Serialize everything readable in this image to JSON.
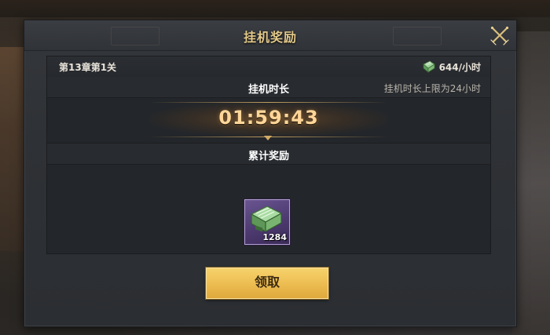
{
  "dialog": {
    "title": "挂机奖励",
    "close_icon": "crossed-swords-close-icon"
  },
  "stage": {
    "label": "第13章第1关",
    "rate_icon": "green-book-icon",
    "rate": "644/小时"
  },
  "duration": {
    "label": "挂机时长",
    "limit_note": "挂机时长上限为24小时",
    "timer": "01:59:43"
  },
  "rewards": {
    "label": "累计奖励",
    "items": [
      {
        "icon": "green-book-icon",
        "count": "1284",
        "rarity_color": "#6a5591"
      }
    ]
  },
  "claim_button": {
    "label": "领取"
  },
  "colors": {
    "title_gold": "#e3c98a",
    "timer_gold": "#ffd699",
    "button_gold": "#eec055"
  }
}
